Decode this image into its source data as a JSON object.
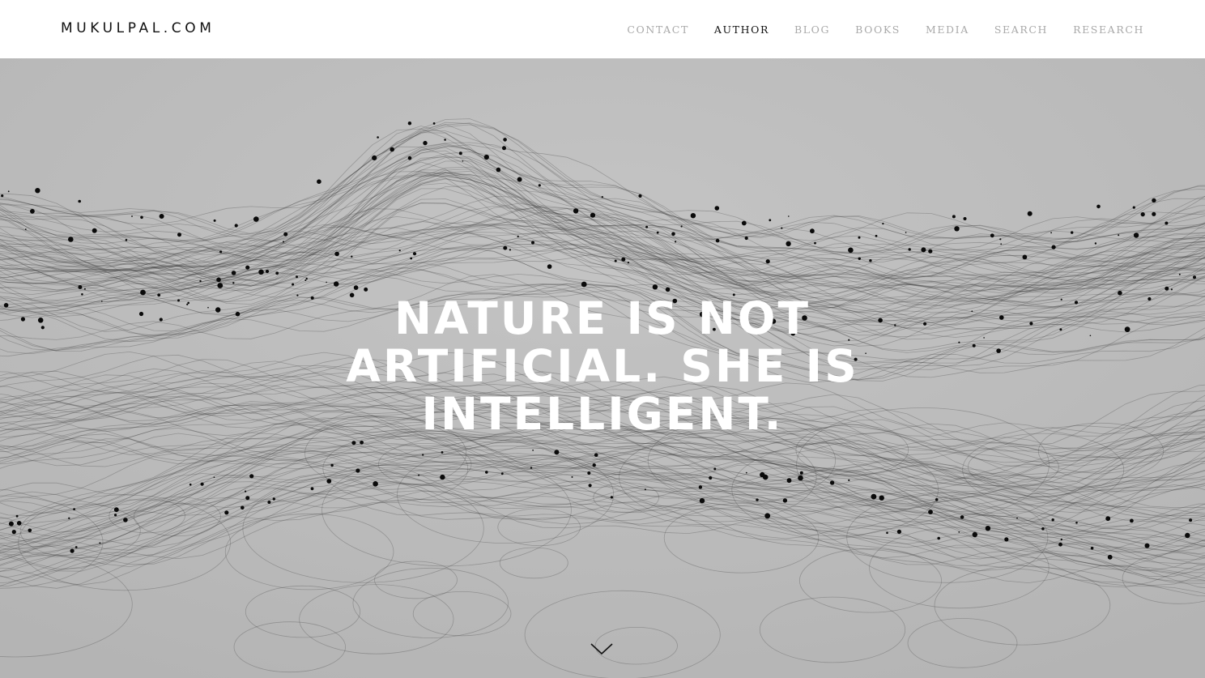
{
  "header": {
    "logo": "MUKULPAL.COM",
    "nav": [
      {
        "label": "CONTACT",
        "active": false
      },
      {
        "label": "AUTHOR",
        "active": true
      },
      {
        "label": "BLOG",
        "active": false
      },
      {
        "label": "BOOKS",
        "active": false
      },
      {
        "label": "MEDIA",
        "active": false
      },
      {
        "label": "SEARCH",
        "active": false
      },
      {
        "label": "RESEARCH",
        "active": false
      }
    ]
  },
  "hero": {
    "headline": "NATURE IS NOT ARTIFICIAL. SHE IS INTELLIGENT.",
    "background_color": "#bdbdbd",
    "scroll_icon": "chevron-down-icon"
  },
  "colors": {
    "nav_active": "#111111",
    "nav_inactive": "#a9a9a9",
    "headline": "#ffffff"
  }
}
